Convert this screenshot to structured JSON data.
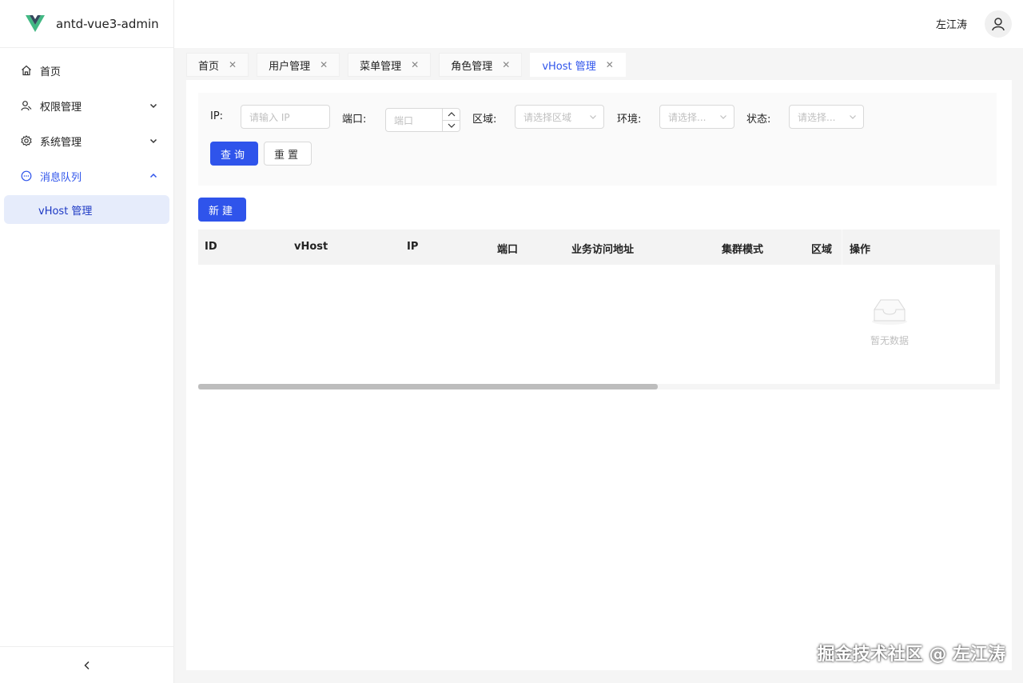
{
  "app": {
    "title": "antd-vue3-admin"
  },
  "sidebar": {
    "items": [
      {
        "label": "首页",
        "icon": "home-icon"
      },
      {
        "label": "权限管理",
        "icon": "user-permission-icon"
      },
      {
        "label": "系统管理",
        "icon": "gear-icon"
      },
      {
        "label": "消息队列",
        "icon": "message-icon"
      }
    ],
    "submenu": {
      "label": "vHost 管理"
    }
  },
  "header": {
    "user_name": "左江涛"
  },
  "tabs": [
    {
      "label": "首页"
    },
    {
      "label": "用户管理"
    },
    {
      "label": "菜单管理"
    },
    {
      "label": "角色管理"
    },
    {
      "label": "vHost 管理",
      "active": true
    }
  ],
  "search": {
    "ip_label": "IP:",
    "ip_placeholder": "请输入 IP",
    "port_label": "端口:",
    "port_placeholder": "端口",
    "region_label": "区域:",
    "region_placeholder": "请选择区域",
    "env_label": "环境:",
    "env_placeholder": "请选择...",
    "status_label": "状态:",
    "status_placeholder": "请选择...",
    "query_label": "查询",
    "reset_label": "重置"
  },
  "actions": {
    "new_label": "新建"
  },
  "table": {
    "columns": [
      "ID",
      "vHost",
      "IP",
      "端口",
      "业务访问地址",
      "集群模式",
      "区域",
      "操作"
    ],
    "empty_text": "暂无数据"
  },
  "watermark": "掘金技术社区 @ 左江涛",
  "colors": {
    "primary": "#2f54eb",
    "selected_bg": "#e6ecfb"
  }
}
